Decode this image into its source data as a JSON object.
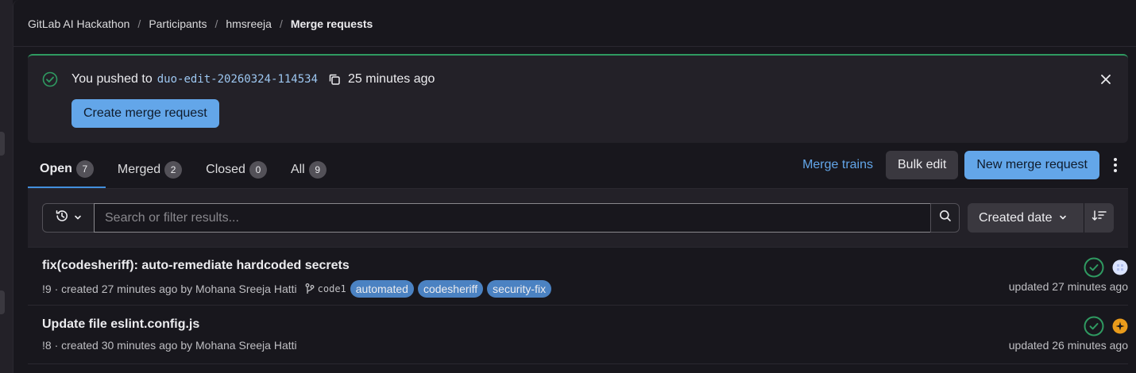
{
  "breadcrumb": {
    "items": [
      "GitLab AI Hackathon",
      "Participants",
      "hmsreeja"
    ],
    "current": "Merge requests"
  },
  "alert": {
    "prefix": "You pushed to",
    "branch": "duo-edit-20260324-114534",
    "time": "25 minutes ago",
    "create_button": "Create merge request",
    "accent_color": "#2f9a61"
  },
  "tabs": [
    {
      "label": "Open",
      "count": "7"
    },
    {
      "label": "Merged",
      "count": "2"
    },
    {
      "label": "Closed",
      "count": "0"
    },
    {
      "label": "All",
      "count": "9"
    }
  ],
  "actions": {
    "merge_trains": "Merge trains",
    "bulk_edit": "Bulk edit",
    "new_mr": "New merge request"
  },
  "filter": {
    "placeholder": "Search or filter results...",
    "sort_label": "Created date"
  },
  "merge_requests": [
    {
      "title": "fix(codesheriff): auto-remediate hardcoded secrets",
      "meta": "!9 · created 27 minutes ago by Mohana Sreeja Hatti",
      "branch": "code1",
      "labels": [
        "automated",
        "codesheriff",
        "security-fix"
      ],
      "updated": "updated 27 minutes ago",
      "pipeline_status": "passed",
      "reviewer_icon": "avatar-icon"
    },
    {
      "title": "Update file eslint.config.js",
      "meta": "!8 · created 30 minutes ago by Mohana Sreeja Hatti",
      "updated": "updated 26 minutes ago",
      "pipeline_status": "passed",
      "reviewer_icon": "duo-icon"
    }
  ],
  "colors": {
    "link": "#63a6e9",
    "success": "#2f9a61",
    "label_bg": "#4b82c2",
    "warning": "#e99b1b"
  }
}
